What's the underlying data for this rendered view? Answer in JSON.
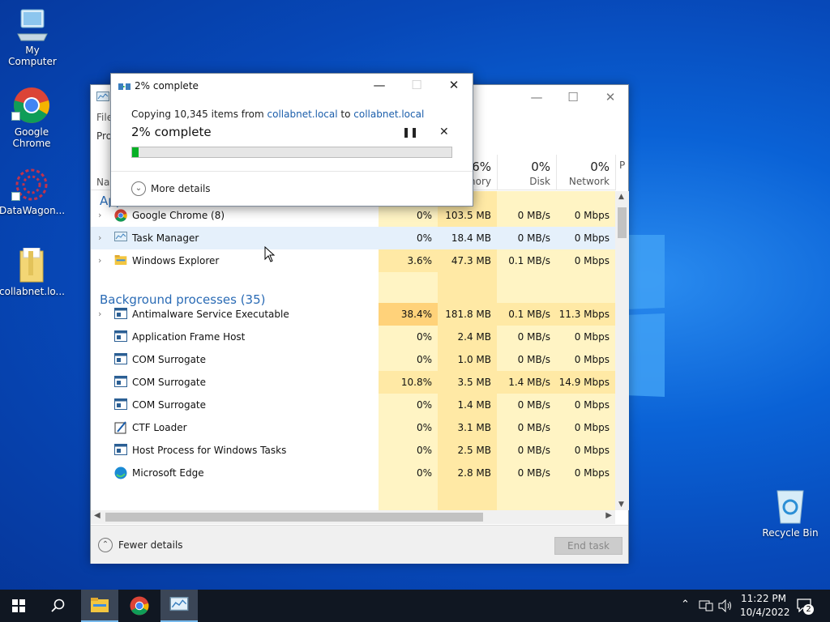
{
  "desktop": {
    "icons": [
      {
        "label": "My Computer"
      },
      {
        "label": "Google Chrome"
      },
      {
        "label": "DataWagon..."
      },
      {
        "label": "collabnet.lo..."
      },
      {
        "label": "Recycle Bin"
      }
    ]
  },
  "task_manager": {
    "menu_partial": "File",
    "tab_partial": "Pro",
    "name_header_partial": "Na",
    "columns": [
      {
        "pct": "6%",
        "label": "mory"
      },
      {
        "pct": "0%",
        "label": "Disk"
      },
      {
        "pct": "0%",
        "label": "Network"
      },
      {
        "pct": "",
        "label": "P"
      }
    ],
    "groups": {
      "apps": "Apps (3)",
      "background": "Background processes (35)"
    },
    "rows": [
      {
        "name": "Google Chrome (8)",
        "cpu": "0%",
        "mem": "103.5 MB",
        "disk": "0 MB/s",
        "net": "0 Mbps"
      },
      {
        "name": "Task Manager",
        "cpu": "0%",
        "mem": "18.4 MB",
        "disk": "0 MB/s",
        "net": "0 Mbps"
      },
      {
        "name": "Windows Explorer",
        "cpu": "3.6%",
        "mem": "47.3 MB",
        "disk": "0.1 MB/s",
        "net": "0 Mbps"
      },
      {
        "name": "Antimalware Service Executable",
        "cpu": "38.4%",
        "mem": "181.8 MB",
        "disk": "0.1 MB/s",
        "net": "11.3 Mbps"
      },
      {
        "name": "Application Frame Host",
        "cpu": "0%",
        "mem": "2.4 MB",
        "disk": "0 MB/s",
        "net": "0 Mbps"
      },
      {
        "name": "COM Surrogate",
        "cpu": "0%",
        "mem": "1.0 MB",
        "disk": "0 MB/s",
        "net": "0 Mbps"
      },
      {
        "name": "COM Surrogate",
        "cpu": "10.8%",
        "mem": "3.5 MB",
        "disk": "1.4 MB/s",
        "net": "14.9 Mbps"
      },
      {
        "name": "COM Surrogate",
        "cpu": "0%",
        "mem": "1.4 MB",
        "disk": "0 MB/s",
        "net": "0 Mbps"
      },
      {
        "name": "CTF Loader",
        "cpu": "0%",
        "mem": "3.1 MB",
        "disk": "0 MB/s",
        "net": "0 Mbps"
      },
      {
        "name": "Host Process for Windows Tasks",
        "cpu": "0%",
        "mem": "2.5 MB",
        "disk": "0 MB/s",
        "net": "0 Mbps"
      },
      {
        "name": "Microsoft Edge",
        "cpu": "0%",
        "mem": "2.8 MB",
        "disk": "0 MB/s",
        "net": "0 Mbps"
      }
    ],
    "fewer_details": "Fewer details",
    "end_task": "End task"
  },
  "copy_dialog": {
    "title": "2% complete",
    "copying_prefix": "Copying 10,345 items from ",
    "source": "collabnet.local",
    "to_word": " to ",
    "destination": "collabnet.local",
    "status": "2% complete",
    "progress_percent": 2,
    "more_details": "More details"
  },
  "taskbar": {
    "time": "11:22 PM",
    "date": "10/4/2022",
    "notification_count": "2"
  },
  "colors": {
    "accent": "#2a6bb5",
    "progress": "#06b025",
    "heat_light": "#fff4c4",
    "heat_mid": "#ffe9a5",
    "heat_high": "#ffd27a"
  }
}
